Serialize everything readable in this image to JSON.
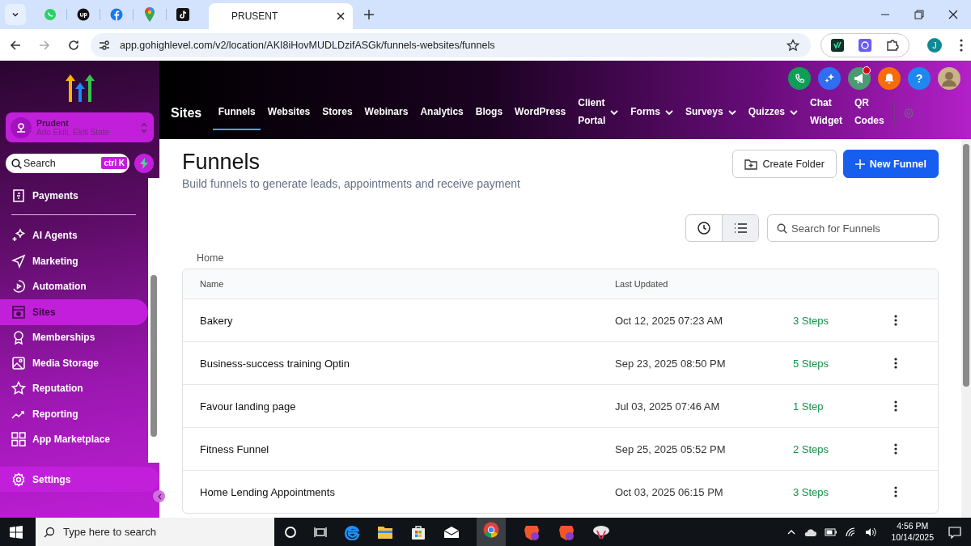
{
  "browser": {
    "active_tab": {
      "title": "PRUSENT"
    },
    "url": "app.gohighlevel.com/v2/location/AKI8iHovMUDLDzifASGk/funnels-websites/funnels",
    "profile": "J"
  },
  "account": {
    "name": "Prudent",
    "location": "Ado Ekiti, Ekiti State"
  },
  "sidebar_search": {
    "placeholder": "Search",
    "shortcut": "ctrl K"
  },
  "sidebar": {
    "items": [
      {
        "label": "Payments",
        "selected": false
      },
      {
        "label": "AI Agents",
        "selected": false
      },
      {
        "label": "Marketing",
        "selected": false
      },
      {
        "label": "Automation",
        "selected": false
      },
      {
        "label": "Sites",
        "selected": true
      },
      {
        "label": "Memberships",
        "selected": false
      },
      {
        "label": "Media Storage",
        "selected": false
      },
      {
        "label": "Reputation",
        "selected": false
      },
      {
        "label": "Reporting",
        "selected": false
      },
      {
        "label": "App Marketplace",
        "selected": false
      }
    ],
    "settings": "Settings"
  },
  "topnav": {
    "section": "Sites",
    "help": "?",
    "tabs": [
      {
        "label": "Funnels",
        "selected": true,
        "dropdown": false
      },
      {
        "label": "Websites",
        "selected": false,
        "dropdown": false
      },
      {
        "label": "Stores",
        "selected": false,
        "dropdown": false
      },
      {
        "label": "Webinars",
        "selected": false,
        "dropdown": false
      },
      {
        "label": "Analytics",
        "selected": false,
        "dropdown": false
      },
      {
        "label": "Blogs",
        "selected": false,
        "dropdown": false
      },
      {
        "label": "WordPress",
        "selected": false,
        "dropdown": false
      },
      {
        "label": "Client Portal",
        "selected": false,
        "dropdown": true
      },
      {
        "label": "Forms",
        "selected": false,
        "dropdown": true
      },
      {
        "label": "Surveys",
        "selected": false,
        "dropdown": true
      },
      {
        "label": "Quizzes",
        "selected": false,
        "dropdown": true
      },
      {
        "label": "Chat Widget",
        "selected": false,
        "dropdown": false
      },
      {
        "label": "QR Codes",
        "selected": false,
        "dropdown": false
      }
    ]
  },
  "page": {
    "title": "Funnels",
    "subtitle": "Build funnels to generate leads, appointments and receive payment",
    "buttons": [
      "Create Folder",
      "New Funnel"
    ],
    "views": [
      {
        "selected": false
      },
      {
        "selected": true
      }
    ],
    "search": {
      "placeholder": "Search for Funnels"
    },
    "breadcrumb": "Home"
  },
  "table": {
    "columns": [
      "Name",
      "Last Updated"
    ],
    "rows": [
      {
        "name": "Bakery",
        "updated": "Oct 12, 2025 07:23 AM",
        "steps": "3 Steps"
      },
      {
        "name": "Business-success training Optin",
        "updated": "Sep 23, 2025 08:50 PM",
        "steps": "5 Steps"
      },
      {
        "name": "Favour landing page",
        "updated": "Jul 03, 2025 07:46 AM",
        "steps": "1 Step"
      },
      {
        "name": "Fitness Funnel",
        "updated": "Sep 25, 2025 05:52 PM",
        "steps": "2 Steps"
      },
      {
        "name": "Home Lending Appointments",
        "updated": "Oct 03, 2025 06:15 PM",
        "steps": "3 Steps"
      }
    ]
  },
  "taskbar": {
    "search_placeholder": "Type here to search",
    "time": "4:56 PM",
    "date": "10/14/2025"
  }
}
